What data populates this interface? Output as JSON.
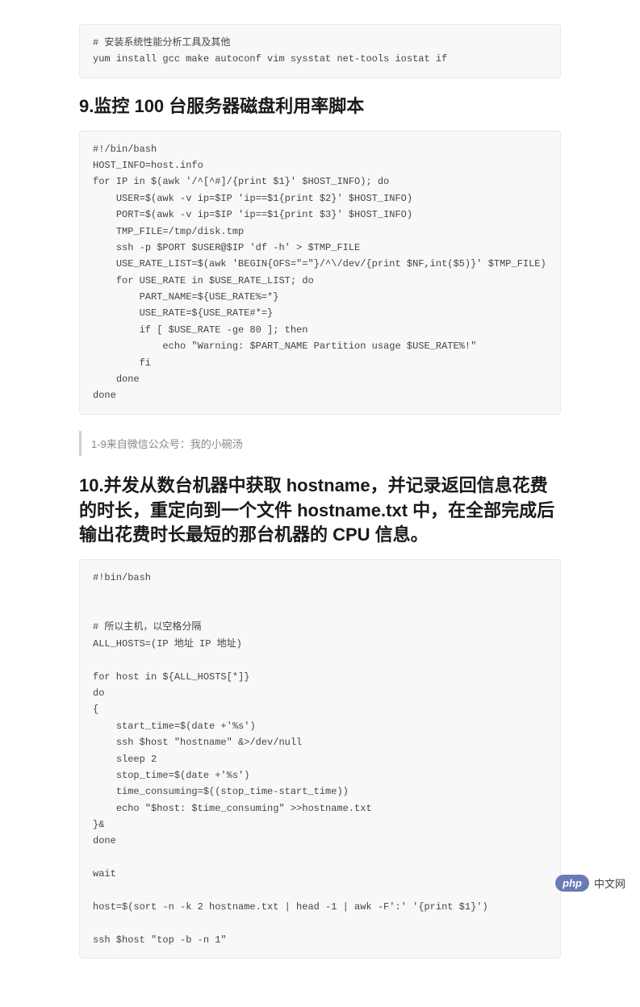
{
  "code_block_1": "# 安装系统性能分析工具及其他\nyum install gcc make autoconf vim sysstat net-tools iostat if",
  "heading_1": "9.监控 100 台服务器磁盘利用率脚本",
  "code_block_2": "#!/bin/bash\nHOST_INFO=host.info\nfor IP in $(awk '/^[^#]/{print $1}' $HOST_INFO); do\n    USER=$(awk -v ip=$IP 'ip==$1{print $2}' $HOST_INFO)\n    PORT=$(awk -v ip=$IP 'ip==$1{print $3}' $HOST_INFO)\n    TMP_FILE=/tmp/disk.tmp\n    ssh -p $PORT $USER@$IP 'df -h' > $TMP_FILE\n    USE_RATE_LIST=$(awk 'BEGIN{OFS=\"=\"}/^\\/dev/{print $NF,int($5)}' $TMP_FILE)\n    for USE_RATE in $USE_RATE_LIST; do\n        PART_NAME=${USE_RATE%=*}\n        USE_RATE=${USE_RATE#*=}\n        if [ $USE_RATE -ge 80 ]; then\n            echo \"Warning: $PART_NAME Partition usage $USE_RATE%!\"\n        fi\n    done\ndone",
  "quote_text": "1-9来自微信公众号：我的小碗汤",
  "heading_2": "10.并发从数台机器中获取 hostname，并记录返回信息花费的时长，重定向到一个文件 hostname.txt 中，在全部完成后输出花费时长最短的那台机器的 CPU 信息。",
  "code_block_3": "#!bin/bash\n\n\n# 所以主机，以空格分隔\nALL_HOSTS=(IP 地址 IP 地址)\n\nfor host in ${ALL_HOSTS[*]}\ndo\n{\n    start_time=$(date +'%s')\n    ssh $host \"hostname\" &>/dev/null\n    sleep 2\n    stop_time=$(date +'%s')\n    time_consuming=$((stop_time-start_time))\n    echo \"$host: $time_consuming\" >>hostname.txt\n}&\ndone\n\nwait\n\nhost=$(sort -n -k 2 hostname.txt | head -1 | awk -F':' '{print $1}')\n\nssh $host \"top -b -n 1\"",
  "footer": {
    "badge": "php",
    "text": "中文网"
  }
}
